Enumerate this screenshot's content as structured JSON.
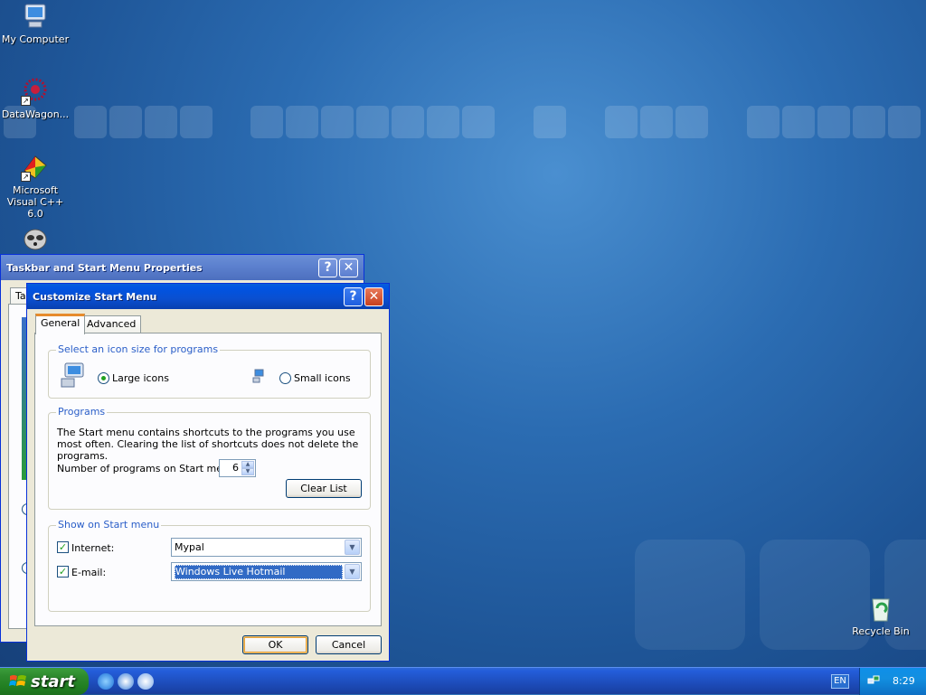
{
  "desktop": {
    "icons": [
      {
        "label": "My Computer"
      },
      {
        "label": "DataWagon..."
      },
      {
        "label": "Microsoft Visual C++ 6.0"
      },
      {
        "label": ""
      },
      {
        "label": "Recycle Bin"
      }
    ]
  },
  "taskbar_properties": {
    "title": "Taskbar and Start Menu Properties",
    "tab_partial": "Ta"
  },
  "customize": {
    "title": "Customize Start Menu",
    "tabs": [
      "General",
      "Advanced"
    ],
    "icon_size": {
      "legend": "Select an icon size for programs",
      "large_label": "Large icons",
      "small_label": "Small icons",
      "selected": "Large icons"
    },
    "programs": {
      "legend": "Programs",
      "description": "The Start menu contains shortcuts to the programs you use most often. Clearing the list of shortcuts does not delete the programs.",
      "number_label": "Number of programs on Start menu:",
      "number_value": "6",
      "clear_label": "Clear List"
    },
    "show": {
      "legend": "Show on Start menu",
      "internet_label": "Internet:",
      "internet_value": "Mypal",
      "internet_checked": true,
      "email_label": "E-mail:",
      "email_value": "Windows Live Hotmail",
      "email_checked": true
    },
    "ok_label": "OK",
    "cancel_label": "Cancel"
  },
  "taskbar": {
    "start_label": "start",
    "language": "EN",
    "clock": "8:29"
  },
  "colors": {
    "title_active": "#0054e3",
    "window_bg": "#ece9d8",
    "start_green": "#2e8b2e",
    "tab_highlight": "#e68b2c",
    "group_label": "#2a5ec8"
  }
}
